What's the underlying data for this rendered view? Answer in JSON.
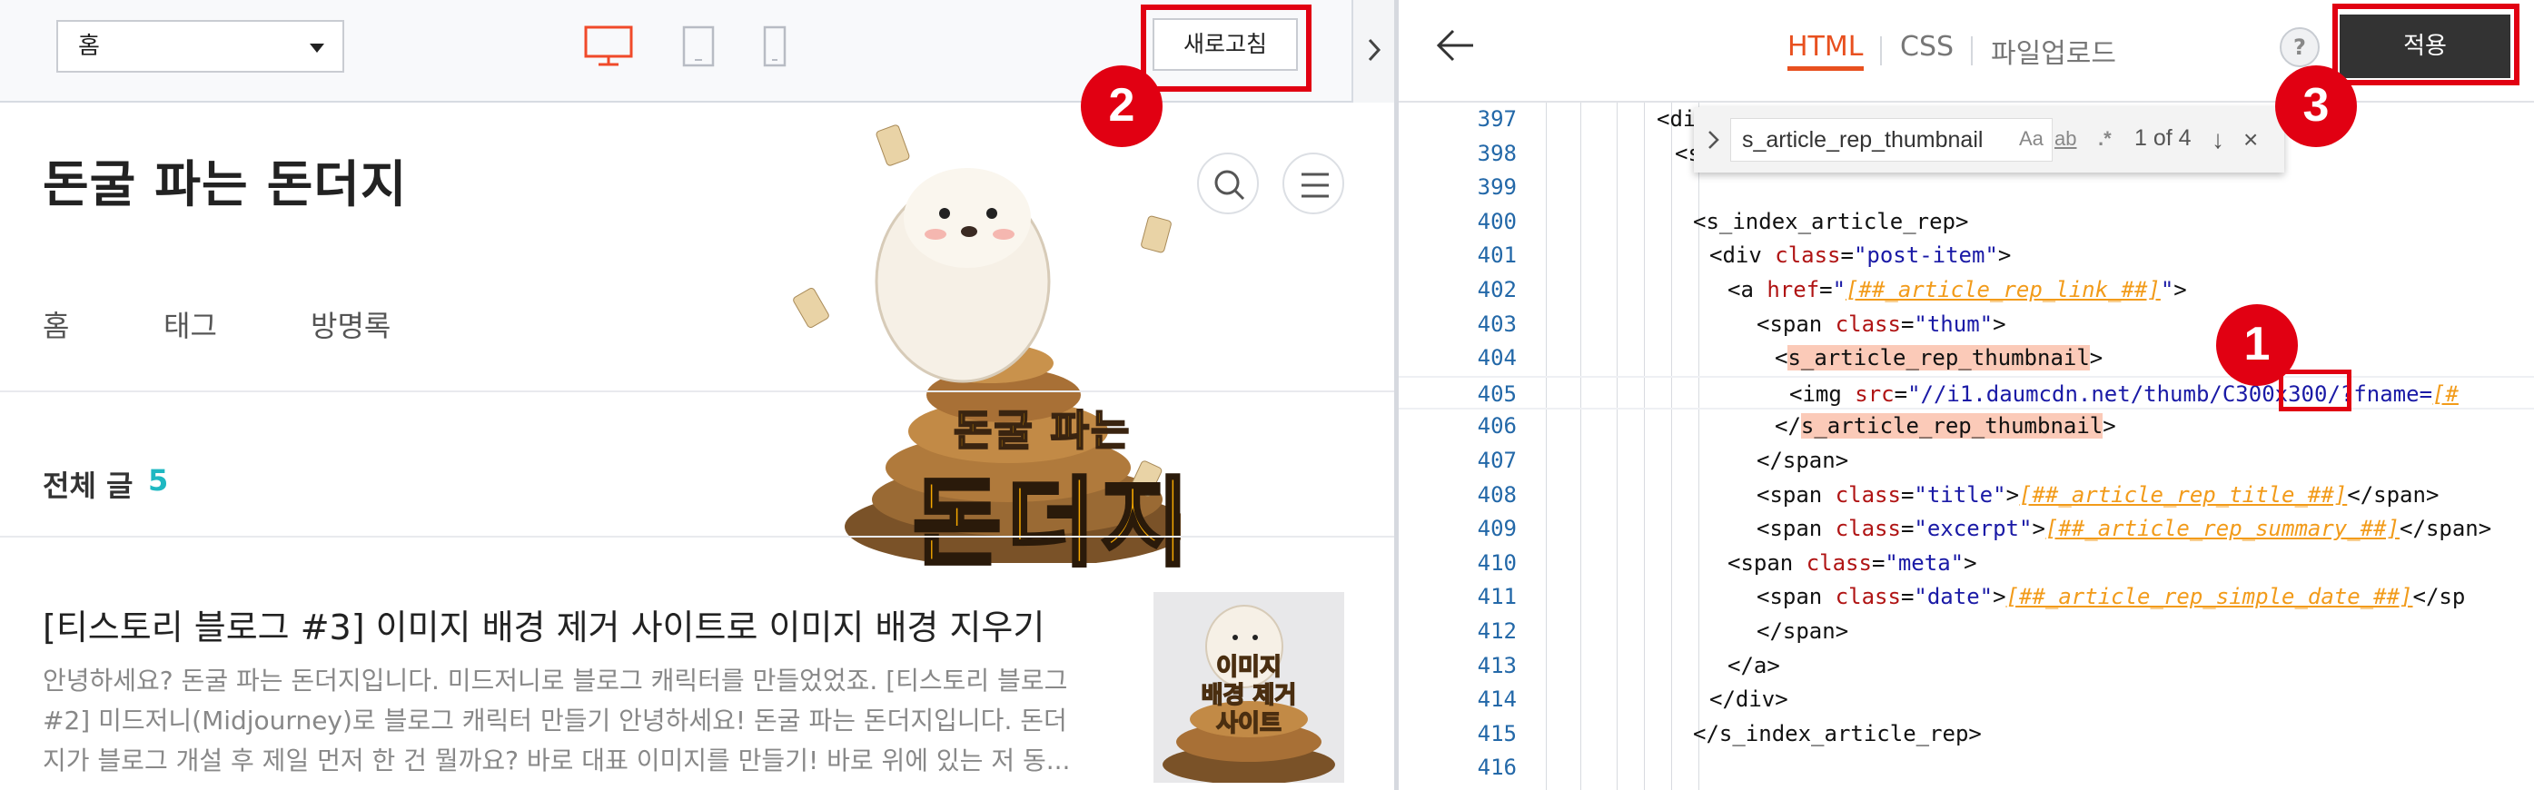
{
  "left": {
    "page_select": "홈",
    "refresh_label": "새로고침",
    "blog_title": "돈굴 파는 돈더지",
    "nav": [
      "홈",
      "태그",
      "방명록"
    ],
    "total_label": "전체 글",
    "total_count": "5",
    "hero_text_small": "돈굴 파는",
    "hero_text_big": "돈더지",
    "post": {
      "title": "[티스토리 블로그 #3] 이미지 배경 제거 사이트로 이미지 배경 지우기",
      "excerpt_lines": [
        "안녕하세요? 돈굴 파는 돈더지입니다. 미드저니로 블로그 캐릭터를 만들었었죠. [티스토리 블로그",
        "#2] 미드저니(Midjourney)로 블로그 캐릭터 만들기 안녕하세요! 돈굴 파는 돈더지입니다. 돈더",
        "지가 블로그 개설 후 제일 먼저 한 건 뭘까요? 바로 대표 이미지를 만들기! 바로 위에 있는 저 동..."
      ],
      "thumb_lines": [
        "이미지",
        "배경 제거",
        "사이트"
      ]
    },
    "badge2": "2"
  },
  "right": {
    "tabs": [
      "HTML",
      "CSS",
      "파일업로드"
    ],
    "help": "?",
    "apply_label": "적용",
    "badge3": "3",
    "badge1": "1",
    "find": {
      "query": "s_article_rep_thumbnail",
      "opt_case": "Aa",
      "opt_word": "ab",
      "opt_regex": ".*",
      "count": "1 of 4"
    },
    "lines": [
      {
        "n": "397",
        "indent": 4,
        "html": "<span class='t'>&lt;div</span>"
      },
      {
        "n": "398",
        "indent": 5,
        "html": "<span class='t'>&lt;s_</span>"
      },
      {
        "n": "399",
        "indent": 0,
        "html": ""
      },
      {
        "n": "400",
        "indent": 6,
        "html": "<span class='t'>&lt;s_index_article_rep&gt;</span>"
      },
      {
        "n": "401",
        "indent": 7,
        "html": "<span class='t'>&lt;div </span><span class='a'>class</span><span class='t'>=</span><span class='s'>\"post-item\"</span><span class='t'>&gt;</span>"
      },
      {
        "n": "402",
        "indent": 8,
        "html": "<span class='t'>&lt;a </span><span class='a'>href</span><span class='t'>=</span><span class='s'>\"</span><span class='p'>[##_article_rep_link_##]</span><span class='s'>\"</span><span class='t'>&gt;</span>"
      },
      {
        "n": "403",
        "indent": 9,
        "html": "<span class='t'>&lt;span </span><span class='a'>class</span><span class='t'>=</span><span class='s'>\"thum\"</span><span class='t'>&gt;</span>"
      },
      {
        "n": "404",
        "indent": 10,
        "html": "<span class='t'>&lt;</span><span class='t hl'>s_article_rep_thumbnail</span><span class='t'>&gt;</span>"
      },
      {
        "n": "405",
        "indent": 11,
        "html": "<span class='t'>&lt;img </span><span class='a'>src</span><span class='t'>=</span><span class='s'>\"//i1.daumcdn.net/thumb/</span><span class='s'>C300x300</span><span class='s'>/?fname=</span><span class='p'>[#</span>"
      },
      {
        "n": "406",
        "indent": 10,
        "html": "<span class='t'>&lt;/</span><span class='t hl'>s_article_rep_thumbnail</span><span class='t'>&gt;</span>"
      },
      {
        "n": "407",
        "indent": 9,
        "html": "<span class='t'>&lt;/span&gt;</span>"
      },
      {
        "n": "408",
        "indent": 9,
        "html": "<span class='t'>&lt;span </span><span class='a'>class</span><span class='t'>=</span><span class='s'>\"title\"</span><span class='t'>&gt;</span><span class='p'>[##_article_rep_title_##]</span><span class='t'>&lt;/span&gt;</span>"
      },
      {
        "n": "409",
        "indent": 9,
        "html": "<span class='t'>&lt;span </span><span class='a'>class</span><span class='t'>=</span><span class='s'>\"excerpt\"</span><span class='t'>&gt;</span><span class='p'>[##_article_rep_summary_##]</span><span class='t'>&lt;/span&gt;</span>"
      },
      {
        "n": "410",
        "indent": 8,
        "html": "<span class='t'>&lt;span </span><span class='a'>class</span><span class='t'>=</span><span class='s'>\"meta\"</span><span class='t'>&gt;</span>"
      },
      {
        "n": "411",
        "indent": 9,
        "html": "<span class='t'>&lt;span </span><span class='a'>class</span><span class='t'>=</span><span class='s'>\"date\"</span><span class='t'>&gt;</span><span class='p'>[##_article_rep_simple_date_##]</span><span class='t'>&lt;/sp</span>"
      },
      {
        "n": "412",
        "indent": 9,
        "html": "<span class='t'>&lt;/span&gt;</span>"
      },
      {
        "n": "413",
        "indent": 8,
        "html": "<span class='t'>&lt;/a&gt;</span>"
      },
      {
        "n": "414",
        "indent": 7,
        "html": "<span class='t'>&lt;/div&gt;</span>"
      },
      {
        "n": "415",
        "indent": 6,
        "html": "<span class='t'>&lt;/s_index_article_rep&gt;</span>"
      },
      {
        "n": "416",
        "indent": 0,
        "html": ""
      }
    ]
  },
  "colors": {
    "accent": "#e8501f",
    "annotation": "#e10012",
    "count_teal": "#1fb8c2"
  }
}
